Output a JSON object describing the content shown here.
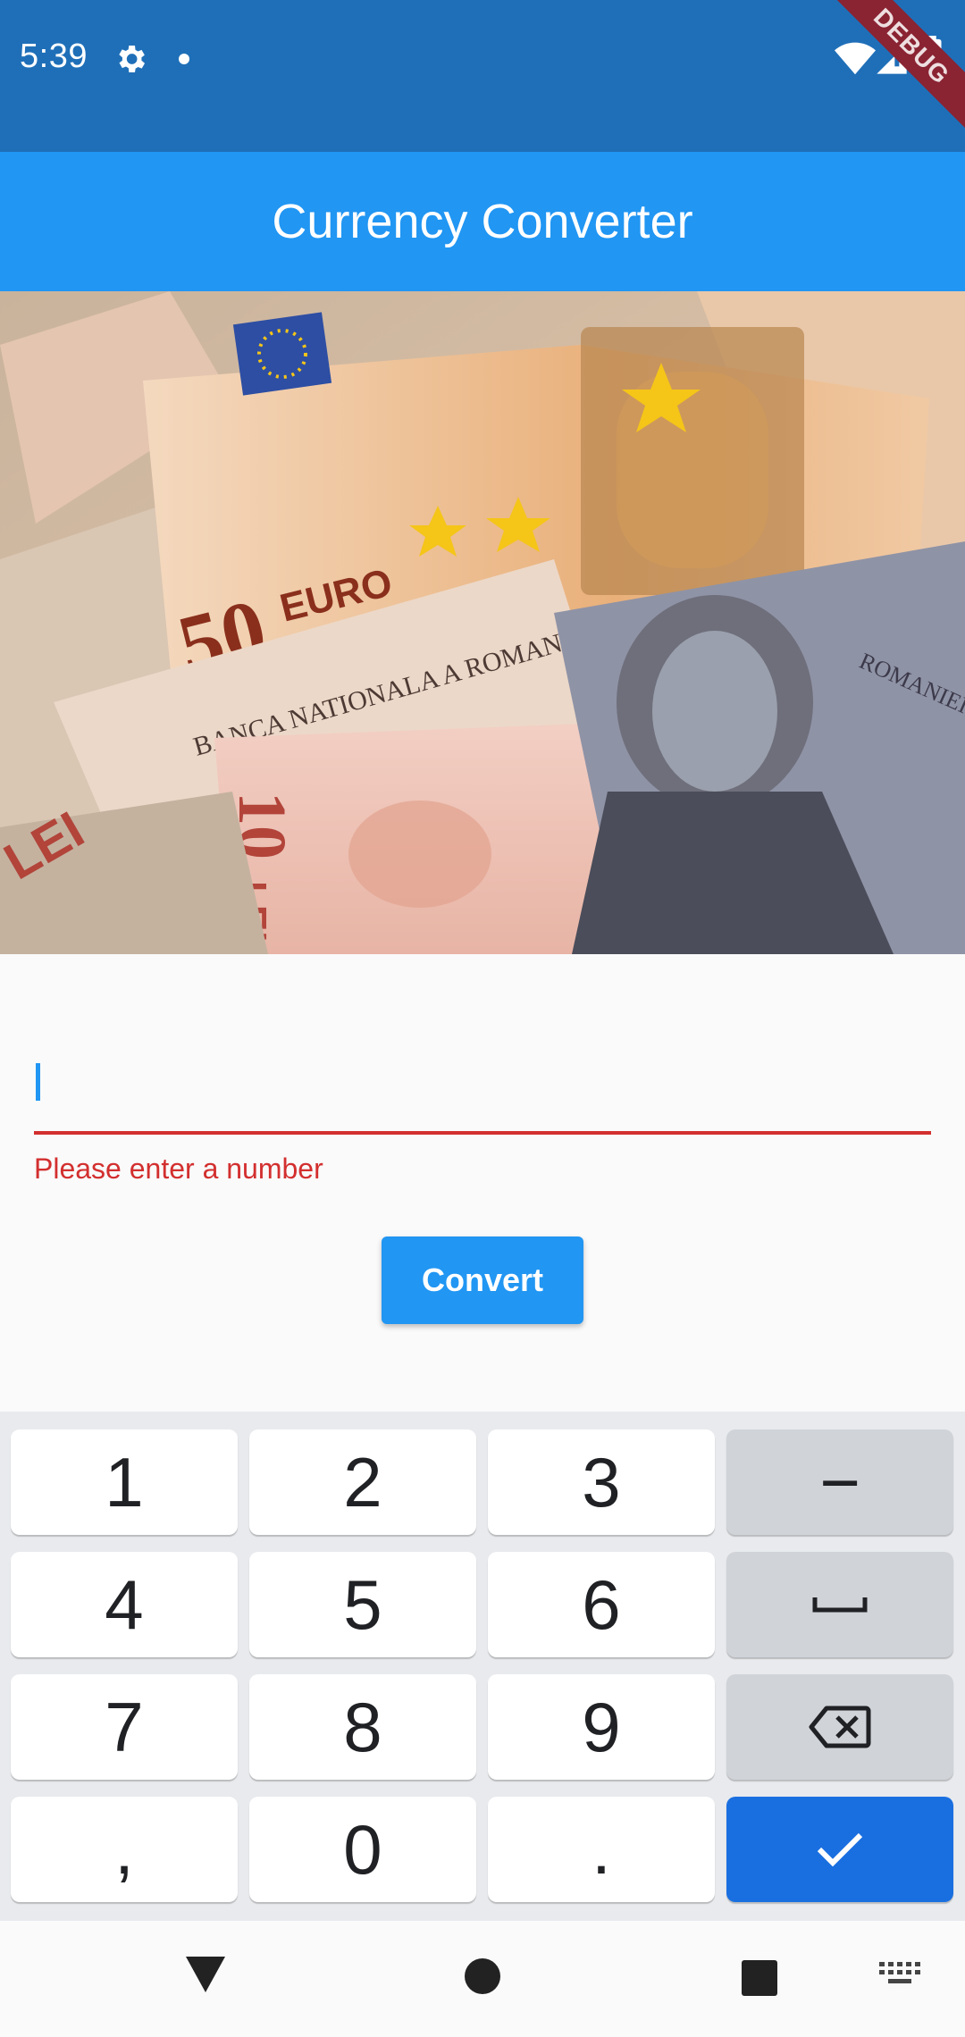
{
  "status_bar": {
    "time": "5:39",
    "debug_label": "DEBUG"
  },
  "app_bar": {
    "title": "Currency Converter"
  },
  "banner": {
    "image_description": "euro-and-lei-banknotes"
  },
  "form": {
    "amount_value": "",
    "error_text": "Please enter a number",
    "convert_label": "Convert"
  },
  "keyboard": {
    "rows": [
      [
        "1",
        "2",
        "3",
        "−"
      ],
      [
        "4",
        "5",
        "6",
        "space"
      ],
      [
        "7",
        "8",
        "9",
        "backspace"
      ],
      [
        ",",
        "0",
        ".",
        "done"
      ]
    ],
    "k1": "1",
    "k2": "2",
    "k3": "3",
    "minus": "−",
    "k4": "4",
    "k5": "5",
    "k6": "6",
    "k7": "7",
    "k8": "8",
    "k9": "9",
    "comma": ",",
    "k0": "0",
    "period": "."
  },
  "colors": {
    "status_bar": "#1f6fb8",
    "app_bar": "#2196f3",
    "error": "#d32f2f",
    "done_key": "#1a6fe0"
  }
}
